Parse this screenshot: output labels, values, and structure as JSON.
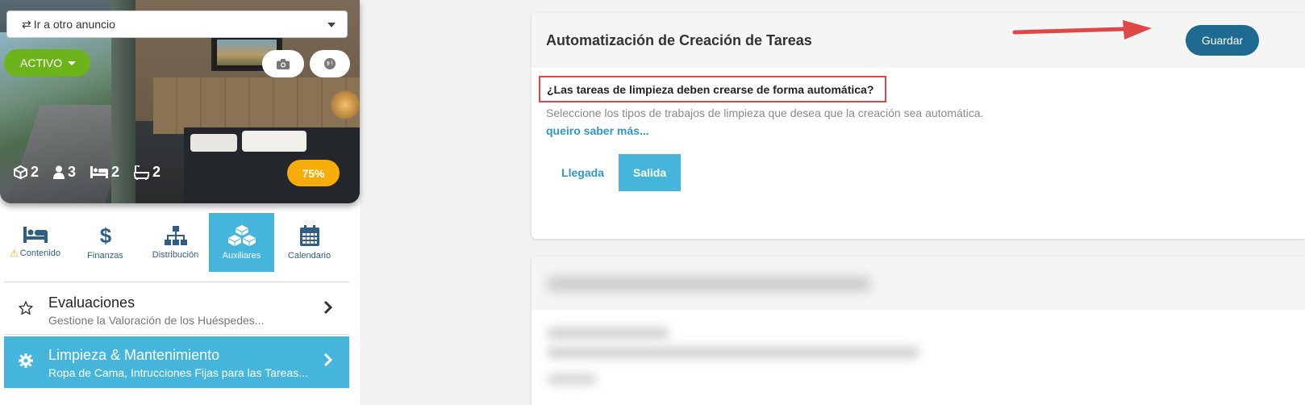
{
  "listing_select": {
    "label": "Ir a otro anuncio",
    "swap_icon": "⇄"
  },
  "status_button": {
    "label": "ACTIVO",
    "color": "#6db31c"
  },
  "stats": {
    "rooms": "2",
    "guests": "3",
    "beds": "2",
    "baths": "2",
    "completion": "75%"
  },
  "tiles": [
    {
      "label": "Contenido",
      "icon": "bed-icon",
      "warning": true
    },
    {
      "label": "Finanzas",
      "icon": "dollar-icon"
    },
    {
      "label": "Distribución",
      "icon": "sitemap-icon"
    },
    {
      "label": "Auxiliares",
      "icon": "cubes-icon",
      "active": true
    },
    {
      "label": "Calendario",
      "icon": "calendar-icon"
    }
  ],
  "menu": [
    {
      "title": "Evaluaciones",
      "subtitle": "Gestione la Valoración de los Huéspedes...",
      "icon": "star-icon"
    },
    {
      "title": "Limpieza & Mantenimiento",
      "subtitle": "Ropa de Cama, Intrucciones Fijas para las Tareas...",
      "icon": "gear-icon",
      "active": true
    }
  ],
  "card": {
    "title": "Automatización de Creación de Tareas",
    "save_label": "Guardar",
    "question": "¿Las tareas de limpieza deben crearse de forma automática?",
    "description": "Seleccione los tipos de trabajos de limpieza que desea que la creación sea automática.",
    "more_link": "queiro saber más...",
    "options": [
      {
        "label": "Llegada",
        "selected": false
      },
      {
        "label": "Salida",
        "selected": true
      }
    ]
  },
  "colors": {
    "accent": "#45b5dc",
    "primary": "#1e6a91",
    "warning": "#f6ad0a",
    "annotation": "#e04848"
  }
}
